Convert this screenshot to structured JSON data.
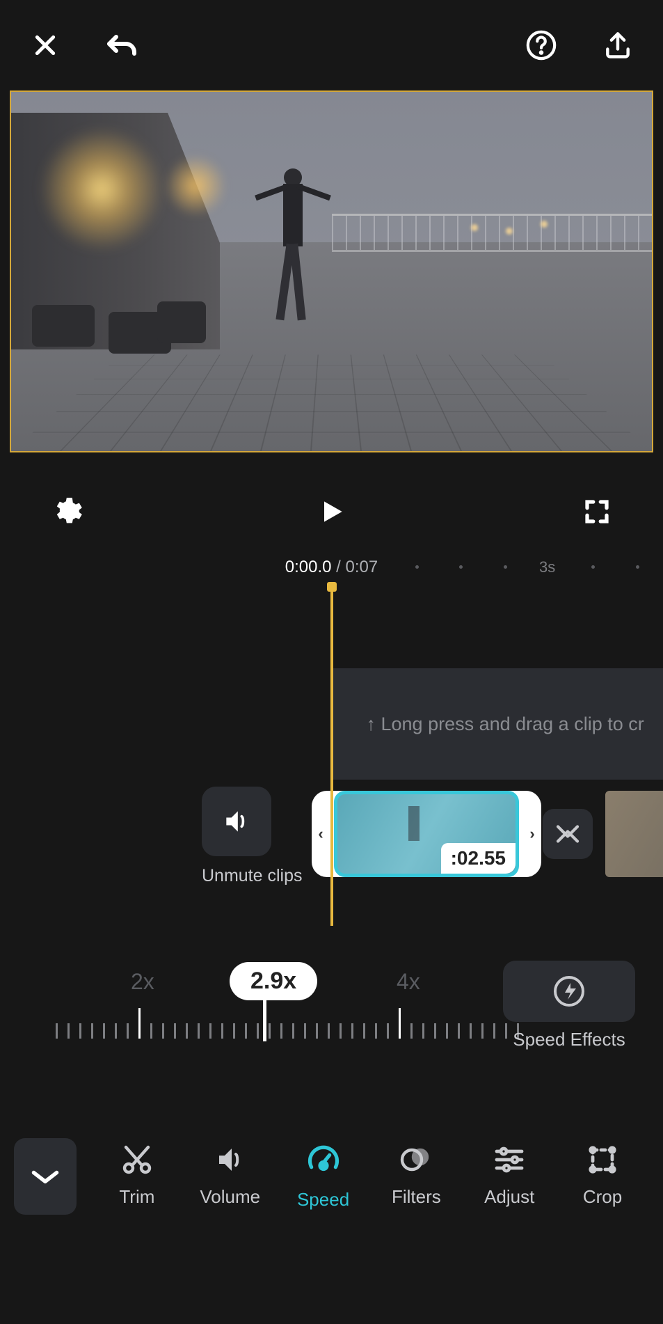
{
  "time": {
    "current": "0:00.0",
    "separator": " / ",
    "total": "0:07",
    "mark_3s": "3s"
  },
  "overlay": {
    "hint": "↑ Long press and drag a clip to cr"
  },
  "clip": {
    "unmute_label": "Unmute clips",
    "selected_duration": ":02.55"
  },
  "speed": {
    "marker_2x": "2x",
    "marker_4x": "4x",
    "current": "2.9x",
    "effects_label": "Speed Effects"
  },
  "tools": {
    "trim": "Trim",
    "volume": "Volume",
    "speed": "Speed",
    "filters": "Filters",
    "adjust": "Adjust",
    "crop": "Crop"
  }
}
